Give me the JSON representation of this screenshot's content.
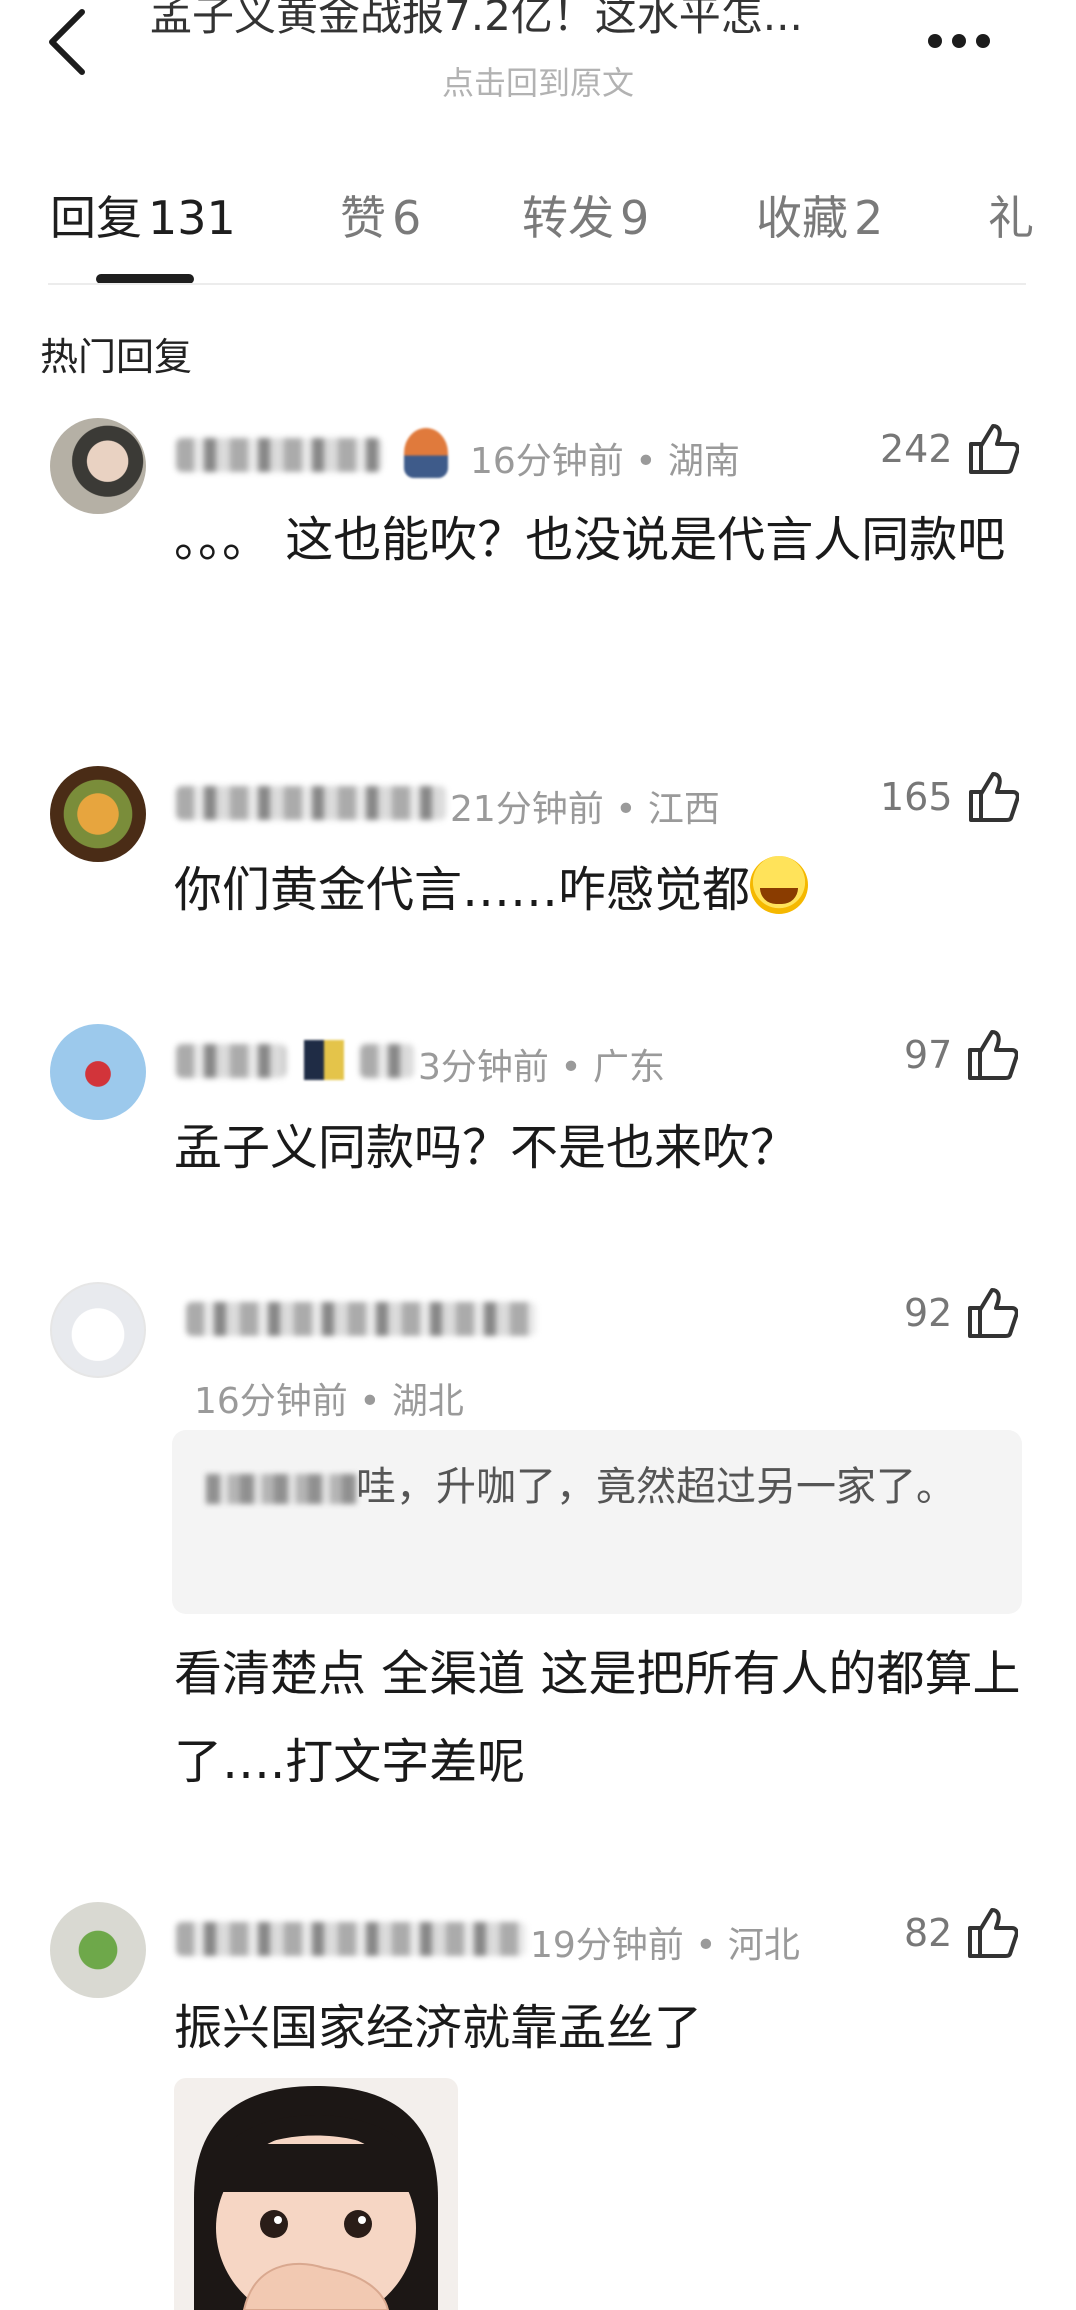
{
  "header": {
    "title": "孟子义黄金战报7.2亿！这水平怎...",
    "subtitle": "点击回到原文"
  },
  "tabs": [
    {
      "label": "回复",
      "count": "131"
    },
    {
      "label": "赞",
      "count": "6"
    },
    {
      "label": "转发",
      "count": "9"
    },
    {
      "label": "收藏",
      "count": "2"
    },
    {
      "label": "礼",
      "count": ""
    }
  ],
  "section_title": "热门回复",
  "comments": [
    {
      "meta": "16分钟前 • 湖南",
      "likes": "242",
      "text": "。。。 这也能吹？也没说是代言人同款吧"
    },
    {
      "meta": "21分钟前 • 江西",
      "likes": "165",
      "text": "你们黄金代言……咋感觉都"
    },
    {
      "meta": "3分钟前 • 广东",
      "likes": "97",
      "text": "孟子义同款吗？不是也来吹？"
    },
    {
      "meta": "16分钟前 • 湖北",
      "likes": "92",
      "quote": "哇，升咖了，竟然超过另一家了。",
      "text": "看清楚点 全渠道 这是把所有人的都算上了….打文字差呢"
    },
    {
      "meta": "19分钟前 • 河北",
      "likes": "82",
      "text": "振兴国家经济就靠孟丝了"
    }
  ],
  "colors": {
    "accent_text": "#1e1e1e",
    "muted": "#9a9a9a",
    "quote_bg": "#f4f4f4"
  },
  "icons": [
    "back-chevron-icon",
    "more-dots-icon",
    "thumbs-up-icon"
  ]
}
